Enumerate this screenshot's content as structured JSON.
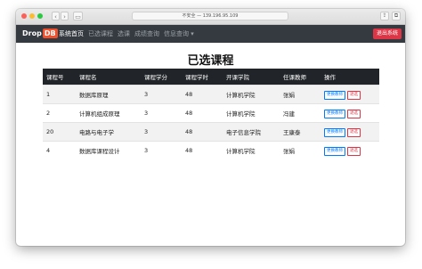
{
  "browser": {
    "address": "不安全 — 139.196.95.109"
  },
  "navbar": {
    "brand_prefix": "Drop",
    "brand_suffix": "DB",
    "items": [
      {
        "label": "系统首页"
      },
      {
        "label": "已选课程"
      },
      {
        "label": "选课"
      },
      {
        "label": "成绩查询"
      },
      {
        "label": "信息查询 ▾"
      }
    ],
    "logout_label": "退出系统"
  },
  "page": {
    "title": "已选课程"
  },
  "table": {
    "headers": [
      "课程号",
      "课程名",
      "课程学分",
      "课程学时",
      "开课学院",
      "任课教师",
      "操作"
    ],
    "rows": [
      {
        "id": "1",
        "name": "数据库原理",
        "credit": "3",
        "hours": "48",
        "college": "计算机学院",
        "teacher": "张娟",
        "change": "更换教师",
        "drop": "退选"
      },
      {
        "id": "2",
        "name": "计算机组成原理",
        "credit": "3",
        "hours": "48",
        "college": "计算机学院",
        "teacher": "冯建",
        "change": "更换教师",
        "drop": "退选"
      },
      {
        "id": "20",
        "name": "电路与电子学",
        "credit": "3",
        "hours": "48",
        "college": "电子信息学院",
        "teacher": "王康泰",
        "change": "更换教师",
        "drop": "退选"
      },
      {
        "id": "4",
        "name": "数据库课程设计",
        "credit": "3",
        "hours": "48",
        "college": "计算机学院",
        "teacher": "张娟",
        "change": "更换教师",
        "drop": "退选"
      }
    ]
  },
  "colors": {
    "navbar_bg": "#343a40",
    "table_header_bg": "#212529",
    "danger": "#dc3545",
    "primary": "#007bff",
    "brand_accent": "#f0502c"
  }
}
